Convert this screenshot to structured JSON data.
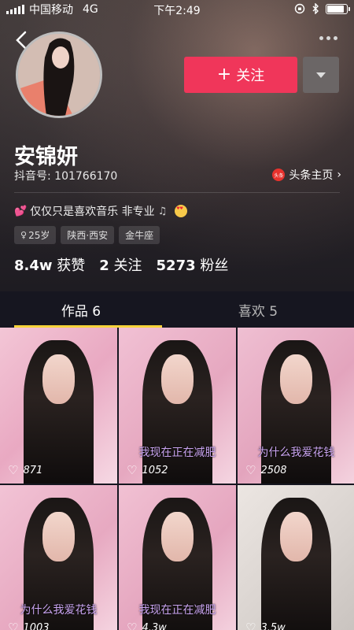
{
  "status_bar": {
    "carrier": "中国移动",
    "network": "4G",
    "time": "下午2:49"
  },
  "profile": {
    "follow_label": "关注",
    "name": "安锦妍",
    "douyin_id": "抖音号: 101766170",
    "toutiao_logo_text": "头条",
    "toutiao_label": "头条主页",
    "bio_text": "仅仅只是喜欢音乐 非专业",
    "tags": [
      "25岁",
      "陕西·西安",
      "金牛座"
    ],
    "stats": {
      "likes_num": "8.4w",
      "likes_label": "获赞",
      "following_num": "2",
      "following_label": "关注",
      "fans_num": "5273",
      "fans_label": "粉丝"
    }
  },
  "tabs": {
    "works": "作品 6",
    "likes": "喜欢 5"
  },
  "videos": [
    {
      "likes": "871",
      "caption": ""
    },
    {
      "likes": "1052",
      "caption": "我现在正在减肥"
    },
    {
      "likes": "2508",
      "caption": "为什么我爱花钱"
    },
    {
      "likes": "1003",
      "caption": "为什么我爱花钱"
    },
    {
      "likes": "4.3w",
      "caption": "我现在正在减肥"
    },
    {
      "likes": "3.5w",
      "caption": ""
    }
  ],
  "colors": {
    "follow_button": "#f0365a",
    "tab_indicator": "#f6d33a"
  },
  "battery_level": 0.9
}
